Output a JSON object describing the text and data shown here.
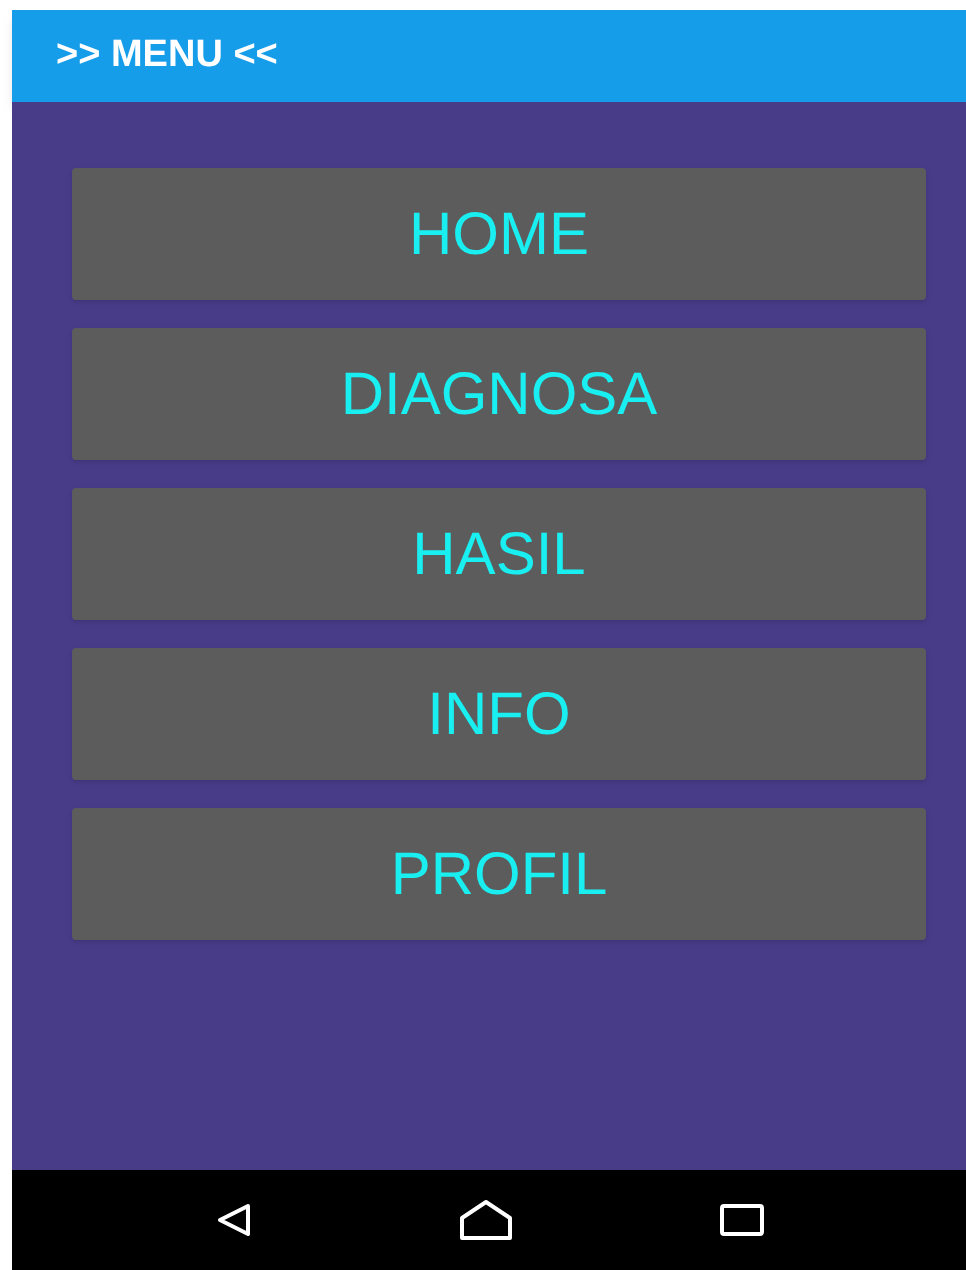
{
  "app_bar": {
    "title": ">> MENU <<"
  },
  "menu_buttons": [
    {
      "label": "HOME"
    },
    {
      "label": "DIAGNOSA"
    },
    {
      "label": "HASIL"
    },
    {
      "label": "INFO"
    },
    {
      "label": "PROFIL"
    }
  ]
}
